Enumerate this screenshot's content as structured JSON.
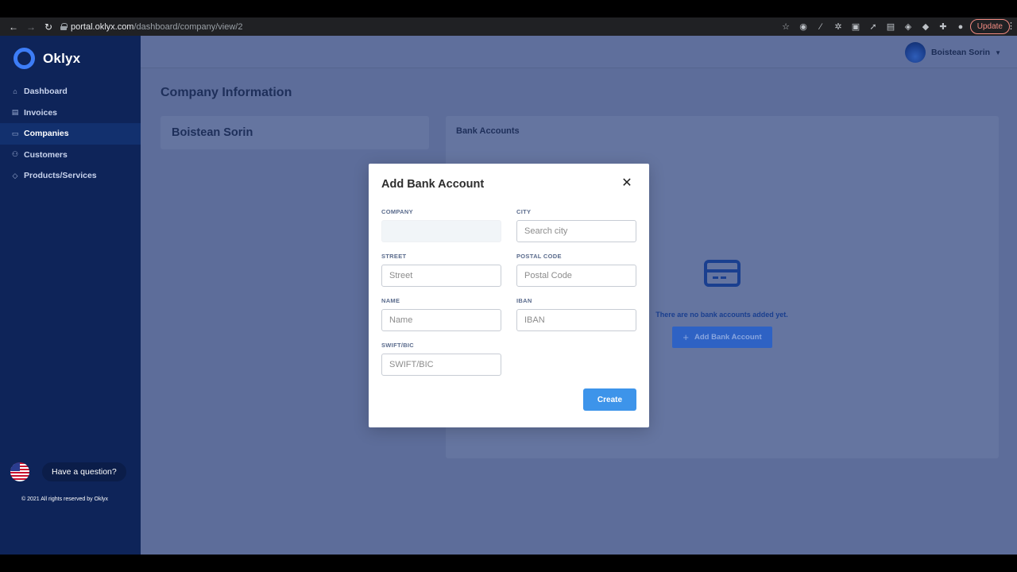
{
  "browser": {
    "url_host": "portal.oklyx.com",
    "url_path": "/dashboard/company/view/2",
    "update_label": "Update"
  },
  "sidebar": {
    "brand": "Oklyx",
    "items": [
      {
        "label": "Dashboard",
        "icon": "home-icon"
      },
      {
        "label": "Invoices",
        "icon": "invoice-icon"
      },
      {
        "label": "Companies",
        "icon": "briefcase-icon",
        "active": true
      },
      {
        "label": "Customers",
        "icon": "users-icon"
      },
      {
        "label": "Products/Services",
        "icon": "tag-icon"
      }
    ],
    "question": "Have a question?",
    "copyright": "© 2021 All rights reserved by Oklyx"
  },
  "header": {
    "user_name": "Boistean Sorin"
  },
  "main": {
    "title": "Company Information",
    "company_name": "Boistean Sorin",
    "bank_title": "Bank Accounts",
    "empty_text": "There are no bank accounts added yet.",
    "add_label": "Add Bank Account"
  },
  "modal": {
    "title": "Add Bank Account",
    "company_label": "COMPANY",
    "company_value": "",
    "city_label": "CITY",
    "city_placeholder": "Search city",
    "street_label": "STREET",
    "street_placeholder": "Street",
    "postal_label": "POSTAL CODE",
    "postal_placeholder": "Postal Code",
    "name_label": "NAME",
    "name_placeholder": "Name",
    "iban_label": "IBAN",
    "iban_placeholder": "IBAN",
    "swift_label": "SWIFT/BIC",
    "swift_placeholder": "SWIFT/BIC",
    "create_label": "Create"
  },
  "colors": {
    "sidebar_bg": "#0e2459",
    "accent": "#3d94ea",
    "overlay_bg": "#5d6d9a"
  }
}
